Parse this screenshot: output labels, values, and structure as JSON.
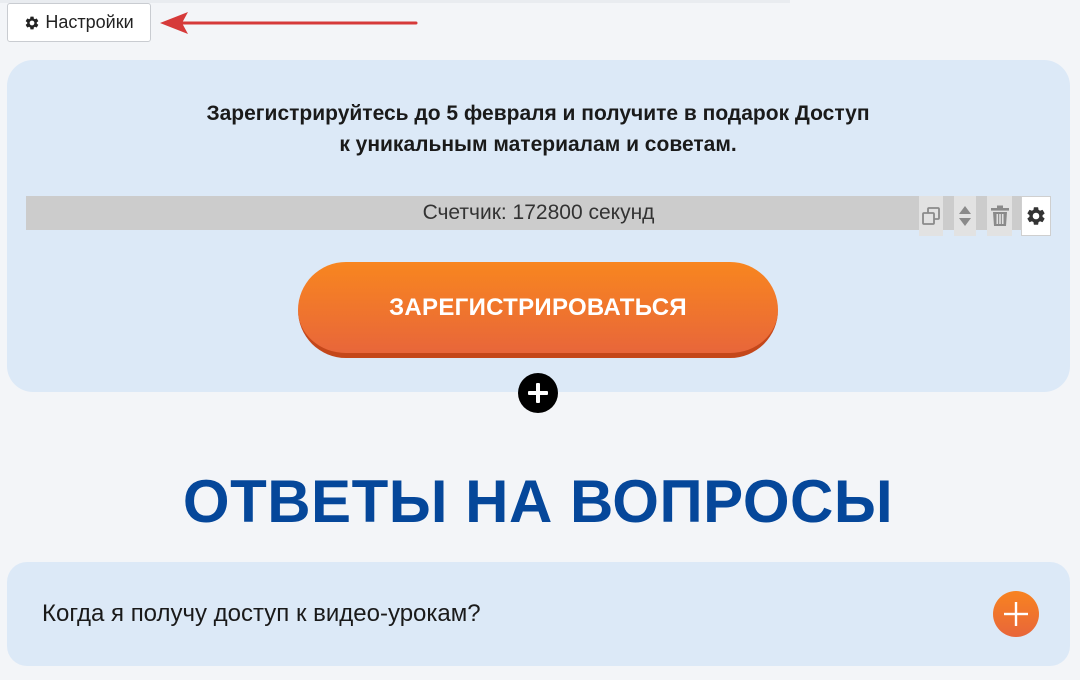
{
  "toolbar": {
    "settings_label": "Настройки"
  },
  "promo": {
    "line1": "Зарегистрируйтесь до 5 февраля и получите в подарок Доступ",
    "line2": "к уникальным материалам и советам.",
    "counter_text": "Счетчик: 172800 секунд",
    "register_label": "ЗАРЕГИСТРИРОВАТЬСЯ",
    "tools": [
      "copy-icon",
      "move-updown-icon",
      "trash-icon",
      "gear-icon"
    ]
  },
  "faq": {
    "title": "ОТВЕТЫ НА ВОПРОСЫ",
    "items": [
      {
        "question": "Когда я получу доступ к видео-урокам?"
      }
    ]
  },
  "colors": {
    "page_bg": "#f3f5f8",
    "card_bg": "#dce9f7",
    "accent_orange": "#f8861f",
    "title_blue": "#05479a",
    "arrow_red": "#d63a3a"
  }
}
